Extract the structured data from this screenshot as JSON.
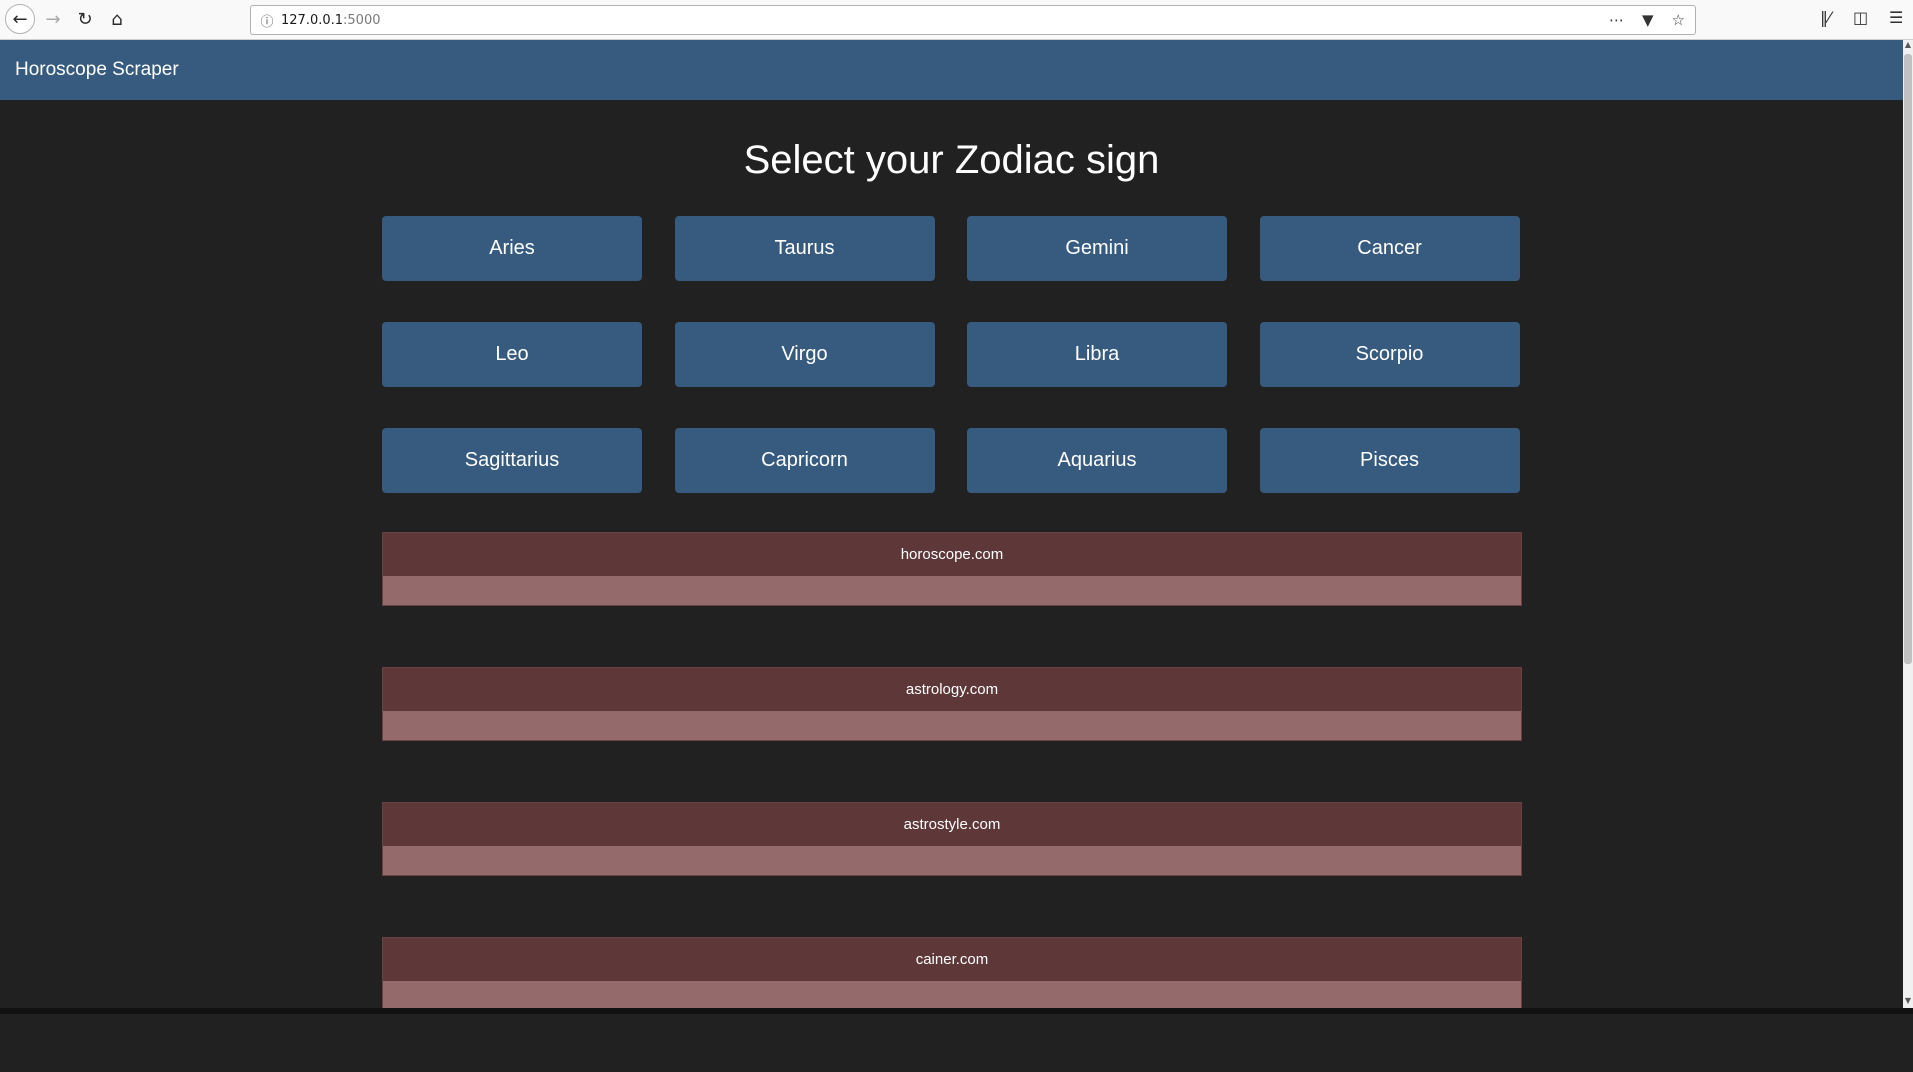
{
  "browser": {
    "url_host": "127.0.0.1",
    "url_port": ":5000",
    "icons": {
      "back": "back-arrow-icon",
      "forward": "forward-arrow-icon",
      "reload": "reload-icon",
      "home": "home-icon",
      "info": "info-icon",
      "more": "more-actions-icon",
      "pocket": "pocket-icon",
      "bookmark": "star-bookmark-icon",
      "library": "library-icon",
      "sidebar": "sidebar-icon",
      "menu": "hamburger-menu-icon"
    }
  },
  "navbar": {
    "brand": "Horoscope Scraper"
  },
  "main": {
    "heading": "Select your Zodiac sign",
    "signs": [
      "Aries",
      "Taurus",
      "Gemini",
      "Cancer",
      "Leo",
      "Virgo",
      "Libra",
      "Scorpio",
      "Sagittarius",
      "Capricorn",
      "Aquarius",
      "Pisces"
    ],
    "sources": [
      "horoscope.com",
      "astrology.com",
      "astrostyle.com",
      "cainer.com"
    ]
  },
  "colors": {
    "background": "#212121",
    "navbar": "#375a7f",
    "sign_button": "#375a7f",
    "card_header": "#5e3739",
    "card_body": "#946a6b"
  }
}
